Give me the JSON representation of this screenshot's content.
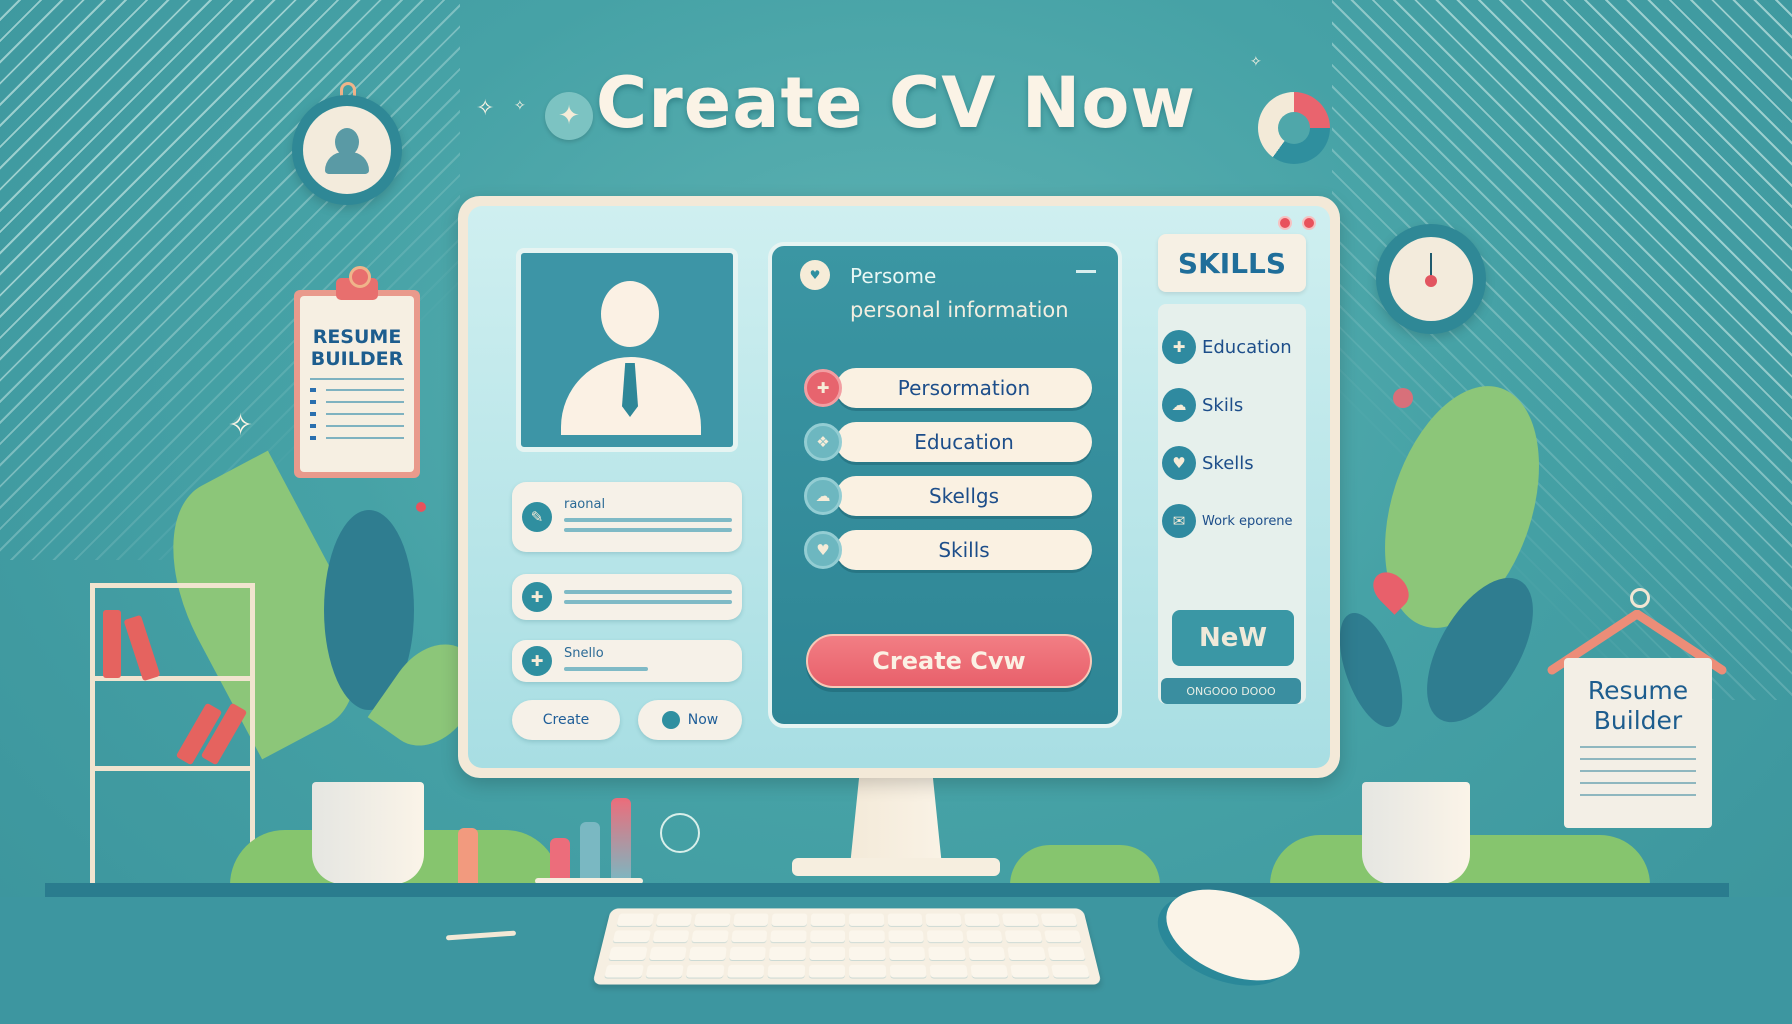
{
  "headline": "Create CV Now",
  "colors": {
    "background": "#46a2a6",
    "accent": "#e8606b",
    "panel": "#2e8595",
    "cream": "#faf1e2",
    "text_dark": "#1d4e8a"
  },
  "clipboard": {
    "title_line1": "RESUME",
    "title_line2": "BUILDER",
    "list_rows": 6
  },
  "hanging_sign": {
    "title_line1": "Resume",
    "title_line2": "Builder"
  },
  "left_column": {
    "cards": [
      {
        "icon": "pin-icon",
        "label": "raonal"
      },
      {
        "icon": "plus-icon",
        "label": ""
      },
      {
        "icon": "plus-icon",
        "label": "Snello"
      }
    ],
    "create_button": "Create",
    "now_button": "Now"
  },
  "form_panel": {
    "title": "Persome",
    "subtitle": "personal information",
    "fields": [
      {
        "icon": "thumbs-up-icon",
        "label": "Persormation",
        "active": true
      },
      {
        "icon": "map-icon",
        "label": "Education",
        "active": false
      },
      {
        "icon": "cloud-icon",
        "label": "Skellgs",
        "active": false
      },
      {
        "icon": "heart-icon",
        "label": "Skills",
        "active": false
      }
    ],
    "primary_button": "Create Cvw"
  },
  "side_panel": {
    "tab_label": "SKILLS",
    "items": [
      {
        "icon": "thumbs-up-icon",
        "label": "Education"
      },
      {
        "icon": "cloud-icon",
        "label": "Skils"
      },
      {
        "icon": "heart-icon",
        "label": "Skells"
      },
      {
        "icon": "chat-icon",
        "label": "Work eporene"
      }
    ],
    "new_button": "NeW",
    "mini_button": "ONGOOO DOOO"
  },
  "icons": {
    "star": "✦",
    "sparkle": "✧",
    "thumbs": "✚",
    "plus": "✚",
    "pin": "✎",
    "heart": "♥",
    "cloud": "☁",
    "map": "❖",
    "chat": "✉"
  }
}
